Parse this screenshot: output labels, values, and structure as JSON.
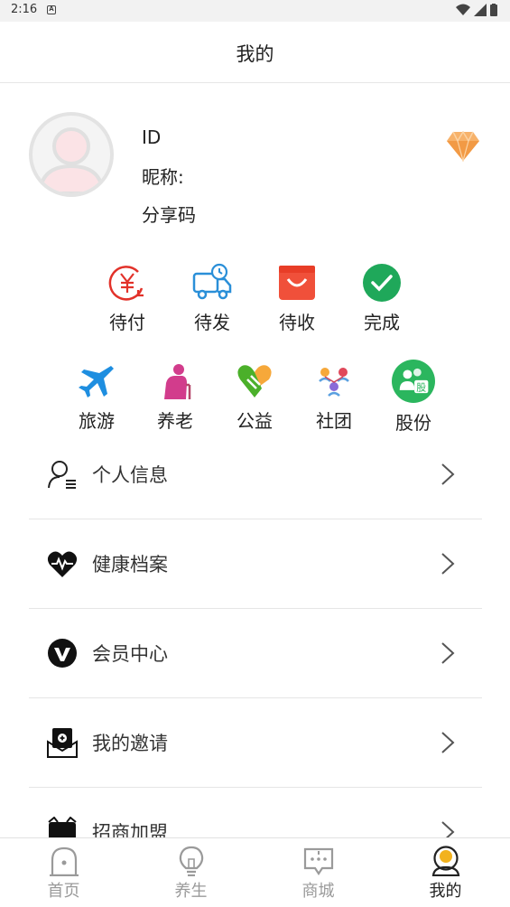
{
  "status_bar": {
    "time": "2:16",
    "notification_glyph": "A"
  },
  "header": {
    "title": "我的"
  },
  "profile": {
    "id_label": "ID",
    "nickname_label": "昵称:",
    "share_code_label": "分享码"
  },
  "orders": [
    {
      "label": "待付",
      "icon": "yen-payment-icon",
      "color": "#e2322a"
    },
    {
      "label": "待发",
      "icon": "delivery-truck-icon",
      "color": "#2a8fd8"
    },
    {
      "label": "待收",
      "icon": "shopping-bag-icon",
      "color": "#f0503a"
    },
    {
      "label": "完成",
      "icon": "check-circle-icon",
      "color": "#1fa85a"
    }
  ],
  "services": [
    {
      "label": "旅游",
      "icon": "airplane-icon",
      "color": "#1e8ee0"
    },
    {
      "label": "养老",
      "icon": "elderly-icon",
      "color": "#d23c8c"
    },
    {
      "label": "公益",
      "icon": "charity-hands-heart-icon",
      "color": "#4bb02a"
    },
    {
      "label": "社团",
      "icon": "community-icon",
      "color": "#d0455c"
    },
    {
      "label": "股份",
      "icon": "shares-icon",
      "color": "#2bb65e",
      "badge_text": "股"
    }
  ],
  "menu": [
    {
      "label": "个人信息",
      "icon": "user-info-icon"
    },
    {
      "label": "健康档案",
      "icon": "health-heart-icon"
    },
    {
      "label": "会员中心",
      "icon": "vip-icon"
    },
    {
      "label": "我的邀请",
      "icon": "invitation-icon"
    },
    {
      "label": "招商加盟",
      "icon": "franchise-icon"
    }
  ],
  "tabs": [
    {
      "label": "首页",
      "icon": "home-icon",
      "active": false
    },
    {
      "label": "养生",
      "icon": "lightbulb-icon",
      "active": false
    },
    {
      "label": "商城",
      "icon": "mall-chat-icon",
      "active": false
    },
    {
      "label": "我的",
      "icon": "profile-icon",
      "active": true
    }
  ],
  "colors": {
    "accent_active": "#f2b21e",
    "diamond": "#f5a04a"
  }
}
